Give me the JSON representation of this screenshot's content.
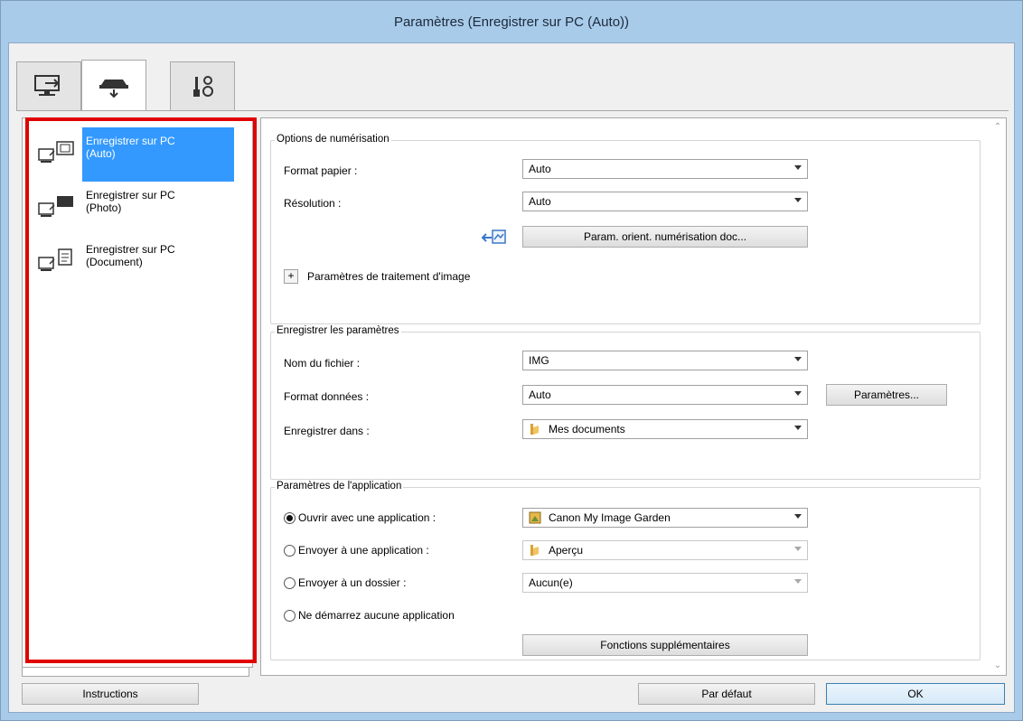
{
  "window": {
    "title": "Paramètres (Enregistrer sur PC (Auto))"
  },
  "tabs": [
    {
      "icon": "scan-from-computer-icon"
    },
    {
      "icon": "scan-from-panel-icon"
    },
    {
      "icon": "general-settings-icon"
    }
  ],
  "left_items": [
    {
      "label_line1": "Enregistrer sur PC",
      "label_line2": "(Auto)",
      "icon": "save-to-pc-auto-icon"
    },
    {
      "label_line1": "Enregistrer sur PC",
      "label_line2": "(Photo)",
      "icon": "save-to-pc-photo-icon"
    },
    {
      "label_line1": "Enregistrer sur PC",
      "label_line2": "(Document)",
      "icon": "save-to-pc-document-icon"
    }
  ],
  "scan_options": {
    "title": "Options de numérisation",
    "paper_size_label": "Format papier :",
    "paper_size_value": "Auto",
    "resolution_label": "Résolution :",
    "resolution_value": "Auto",
    "orient_button": "Param. orient. numérisation doc...",
    "image_processing_label": "Paramètres de traitement d'image",
    "expand_symbol": "+"
  },
  "save_settings": {
    "title": "Enregistrer les paramètres",
    "file_name_label": "Nom du fichier :",
    "file_name_value": "IMG",
    "data_format_label": "Format données :",
    "data_format_value": "Auto",
    "settings_button": "Paramètres...",
    "save_in_label": "Enregistrer dans :",
    "save_in_value": "Mes documents"
  },
  "app_settings": {
    "title": "Paramètres de l'application",
    "open_with_label": "Ouvrir avec une application :",
    "open_with_value": "Canon My Image Garden",
    "send_to_app_label": "Envoyer à une application :",
    "send_to_app_value": "Aperçu",
    "send_to_folder_label": "Envoyer à un dossier :",
    "send_to_folder_value": "Aucun(e)",
    "no_app_label": "Ne démarrez aucune application",
    "more_functions_button": "Fonctions supplémentaires",
    "selected_option": "open_with"
  },
  "footer": {
    "instructions": "Instructions",
    "defaults": "Par défaut",
    "ok": "OK"
  },
  "colors": {
    "title_bg": "#a9cbea",
    "selection": "#3399ff",
    "highlight_frame": "#e00000"
  }
}
